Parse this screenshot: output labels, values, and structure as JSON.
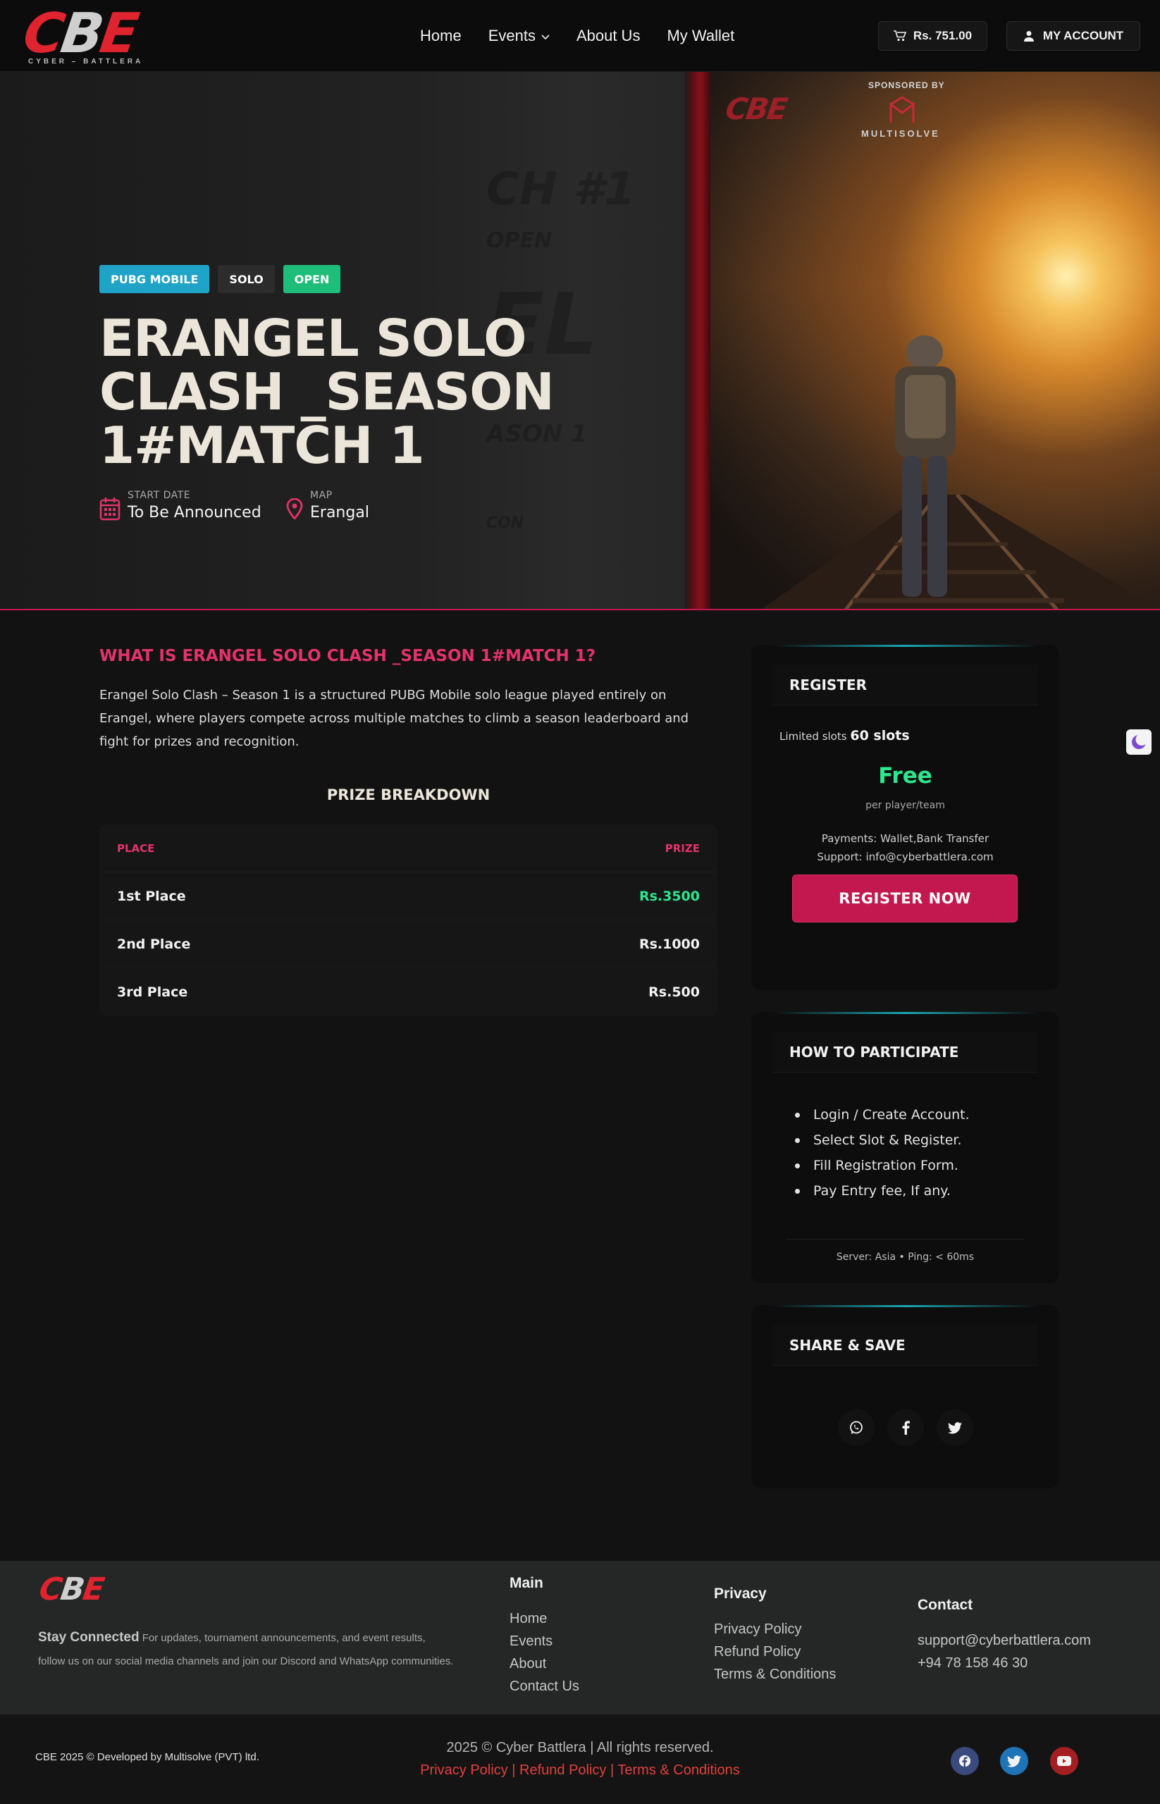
{
  "header": {
    "logo_text": "CBE",
    "logo_subtext": "CYBER – BATTLERA",
    "nav": [
      {
        "label": "Home"
      },
      {
        "label": "Events"
      },
      {
        "label": "About Us"
      },
      {
        "label": "My Wallet"
      }
    ],
    "wallet_balance": "Rs. 751.00",
    "account_label": "MY ACCOUNT"
  },
  "hero": {
    "tags": [
      "PUBG MOBILE",
      "SOLO",
      "OPEN"
    ],
    "title": "ERANGEL SOLO CLASH _SEASON 1#MATCH 1",
    "start_date_label": "START DATE",
    "start_date_value": "To Be Announced",
    "map_label": "MAP",
    "map_value": "Erangal",
    "sponsor_label": "SPONSORED BY",
    "sponsor_name": "MULTISOLVE",
    "ghost_texts": [
      "CH #1",
      "OPEN",
      "EL",
      "ASON 1",
      "CON"
    ]
  },
  "about": {
    "title": "WHAT IS ERANGEL SOLO CLASH _SEASON 1#MATCH 1?",
    "text": "Erangel Solo Clash – Season 1 is a structured PUBG Mobile solo league played entirely on Erangel, where players compete across multiple matches to climb a season leaderboard and fight for prizes and recognition."
  },
  "prizes": {
    "title": "PRIZE BREAKDOWN",
    "col_place": "PLACE",
    "col_prize": "PRIZE",
    "rows": [
      {
        "place": "1st Place",
        "prize": "Rs.3500"
      },
      {
        "place": "2nd Place",
        "prize": "Rs.1000"
      },
      {
        "place": "3rd Place",
        "prize": "Rs.500"
      }
    ]
  },
  "register": {
    "title": "REGISTER",
    "slots_label": "Limited slots",
    "slots_value": "60 slots",
    "price": "Free",
    "per": "per player/team",
    "payments": "Payments: Wallet,Bank Transfer",
    "support": "Support: info@cyberbattlera.com",
    "button": "REGISTER NOW"
  },
  "participate": {
    "title": "HOW TO PARTICIPATE",
    "steps": [
      "Login / Create Account.",
      "Select Slot & Register.",
      "Fill Registration Form.",
      "Pay Entry fee, If any."
    ],
    "server": "Server: Asia • Ping: < 60ms"
  },
  "share": {
    "title": "SHARE & SAVE",
    "icons": [
      "whatsapp-icon",
      "facebook-icon",
      "twitter-icon"
    ]
  },
  "footer": {
    "logo_text": "CBE",
    "stay_title": "Stay Connected",
    "stay_text": "For updates, tournament announcements, and event results, follow us on our social media channels and join our Discord and WhatsApp communities.",
    "main_title": "Main",
    "main_links": [
      "Home",
      "Events",
      "About",
      "Contact Us"
    ],
    "privacy_title": "Privacy",
    "privacy_links": [
      "Privacy Policy",
      "Refund Policy",
      "Terms & Conditions"
    ],
    "contact_title": "Contact",
    "contact_email": "support@cyberbattlera.com",
    "contact_phone": "+94 78 158 46 30"
  },
  "bottom": {
    "developer": "CBE 2025 © Developed by Multisolve (PVT) ltd.",
    "copyright": "2025 © Cyber Battlera | All rights reserved.",
    "legal_links": [
      "Privacy Policy",
      "Refund Policy",
      "Terms & Conditions"
    ],
    "legal_separator": " | ",
    "social_icons": [
      "facebook-icon",
      "twitter-icon",
      "youtube-icon"
    ]
  },
  "colors": {
    "accent": "#c2184f",
    "accent_text": "#e3336b",
    "success": "#2ee68f",
    "tag_pubg": "#1fa3c6",
    "tag_open": "#1fbd7a",
    "teal_line": "#1aa6b2",
    "footer_link_red": "#e2413d"
  }
}
